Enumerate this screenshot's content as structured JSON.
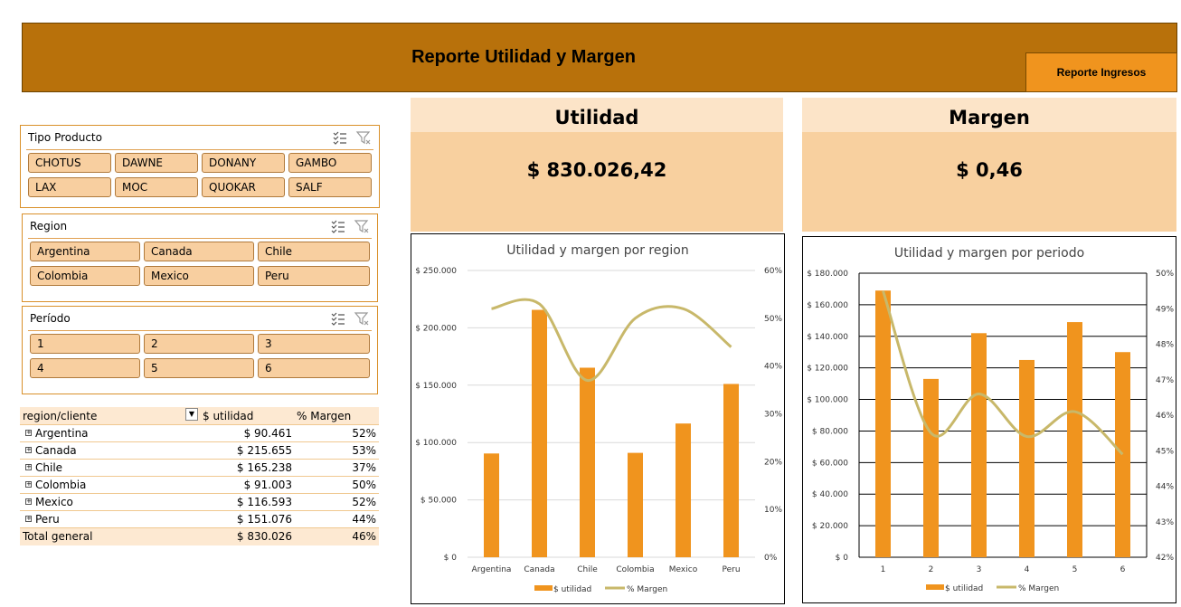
{
  "header": {
    "title": "Reporte Utilidad y Margen",
    "button_label": "Reporte Ingresos"
  },
  "slicers": {
    "tipo_producto": {
      "title": "Tipo Producto",
      "items": [
        "CHOTUS",
        "DAWNE",
        "DONANY",
        "GAMBO",
        "LAX",
        "MOC",
        "QUOKAR",
        "SALF"
      ]
    },
    "region": {
      "title": "Region",
      "items": [
        "Argentina",
        "Canada",
        "Chile",
        "Colombia",
        "Mexico",
        "Peru"
      ]
    },
    "periodo": {
      "title": "Período",
      "items": [
        "1",
        "2",
        "3",
        "4",
        "5",
        "6"
      ]
    }
  },
  "kpis": {
    "utilidad": {
      "title": "Utilidad",
      "value": "$ 830.026,42"
    },
    "margen": {
      "title": "Margen",
      "value": "$ 0,46"
    }
  },
  "pivot": {
    "headers": [
      "region/cliente",
      "$ utilidad",
      "%  Margen"
    ],
    "rows": [
      {
        "name": "Argentina",
        "value": "$ 90.461",
        "margin": "52%"
      },
      {
        "name": "Canada",
        "value": "$ 215.655",
        "margin": "53%"
      },
      {
        "name": "Chile",
        "value": "$ 165.238",
        "margin": "37%"
      },
      {
        "name": "Colombia",
        "value": "$ 91.003",
        "margin": "50%"
      },
      {
        "name": "Mexico",
        "value": "$ 116.593",
        "margin": "52%"
      },
      {
        "name": "Peru",
        "value": "$ 151.076",
        "margin": "44%"
      }
    ],
    "total": {
      "name": "Total general",
      "value": "$ 830.026",
      "margin": "46%"
    }
  },
  "colors": {
    "bar": "#f0941e",
    "line": "#c8b86a",
    "header": "#b8710b"
  },
  "chart_data": [
    {
      "type": "bar",
      "title": "Utilidad y margen por region",
      "categories": [
        "Argentina",
        "Canada",
        "Chile",
        "Colombia",
        "Mexico",
        "Peru"
      ],
      "series": [
        {
          "name": "$ utilidad",
          "type": "bar",
          "axis": "left",
          "values": [
            90461,
            215655,
            165238,
            91003,
            116593,
            151076
          ]
        },
        {
          "name": "% Margen",
          "type": "line",
          "axis": "right",
          "values": [
            52,
            53,
            37,
            50,
            52,
            44
          ]
        }
      ],
      "ylim": [
        0,
        250000
      ],
      "y_ticks": [
        "$ 0",
        "$ 50.000",
        "$ 100.000",
        "$ 150.000",
        "$ 200.000",
        "$ 250.000"
      ],
      "y2lim": [
        0,
        60
      ],
      "y2_ticks": [
        "0%",
        "10%",
        "20%",
        "30%",
        "40%",
        "50%",
        "60%"
      ],
      "grid": true,
      "legend": "bottom"
    },
    {
      "type": "bar",
      "title": "Utilidad y margen por periodo",
      "categories": [
        "1",
        "2",
        "3",
        "4",
        "5",
        "6"
      ],
      "series": [
        {
          "name": "$ utilidad",
          "type": "bar",
          "axis": "left",
          "values": [
            169000,
            113000,
            142000,
            125000,
            149000,
            130000
          ]
        },
        {
          "name": "% Margen",
          "type": "line",
          "axis": "right",
          "values": [
            49.5,
            45.5,
            46.6,
            45.4,
            46.1,
            44.9
          ]
        }
      ],
      "ylim": [
        0,
        180000
      ],
      "y_ticks": [
        "$ 0",
        "$ 20.000",
        "$ 40.000",
        "$ 60.000",
        "$ 80.000",
        "$ 100.000",
        "$ 120.000",
        "$ 140.000",
        "$ 160.000",
        "$ 180.000"
      ],
      "y2lim": [
        42,
        50
      ],
      "y2_ticks": [
        "42%",
        "43%",
        "44%",
        "45%",
        "46%",
        "47%",
        "48%",
        "49%",
        "50%"
      ],
      "grid": true,
      "legend": "bottom"
    }
  ]
}
